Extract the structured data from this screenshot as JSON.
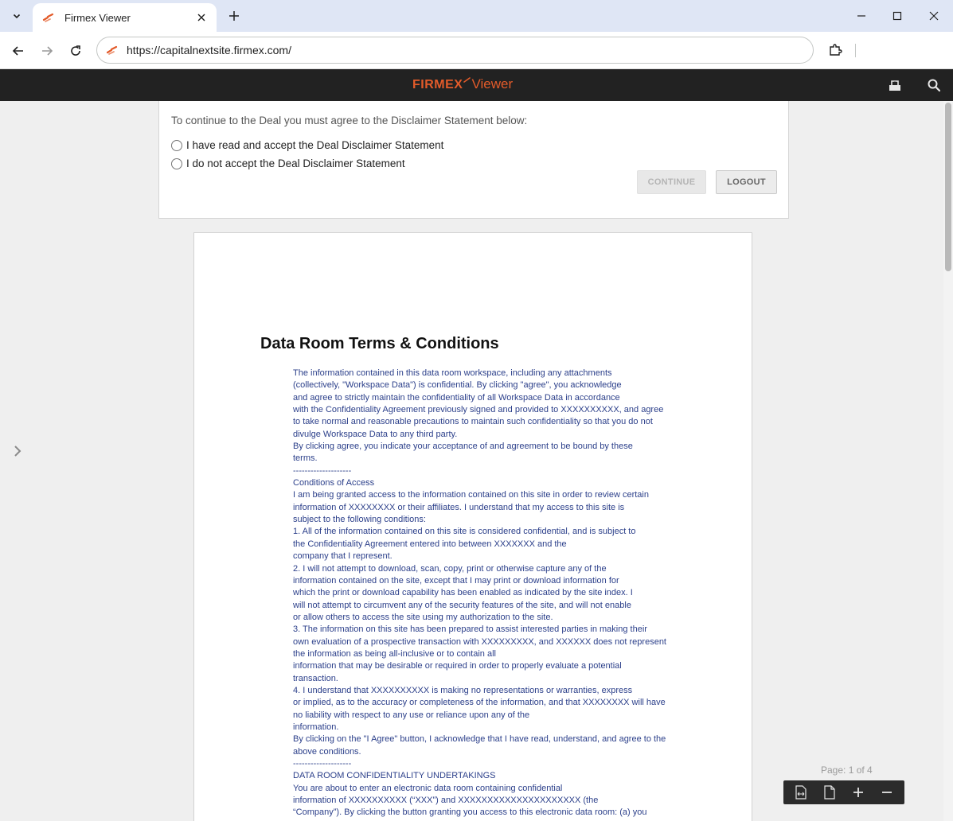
{
  "browser": {
    "tab": {
      "title": "Firmex Viewer"
    },
    "url": "https://capitalnextsite.firmex.com/"
  },
  "header": {
    "brand_firmex": "FIRMEX",
    "brand_viewer": "Viewer"
  },
  "disclaimer": {
    "prompt": "To continue to the Deal you must agree to the Disclaimer Statement below:",
    "accept_label": "I have read and accept the Deal Disclaimer Statement",
    "decline_label": "I do not accept the Deal Disclaimer Statement",
    "continue_label": "CONTINUE",
    "logout_label": "LOGOUT"
  },
  "document": {
    "title": "Data Room Terms & Conditions",
    "lines": [
      "The information contained in this data room workspace, including any attachments",
      "(collectively, \"Workspace Data\") is confidential. By clicking \"agree\", you acknowledge",
      "and agree to strictly maintain the confidentiality of all Workspace Data in accordance",
      "with the Confidentiality Agreement previously signed and provided to XXXXXXXXXX, and agree",
      "to take normal and reasonable precautions to maintain such confidentiality so that you do not",
      "divulge Workspace Data to any third party.",
      "By clicking agree, you indicate your acceptance of and agreement to be bound by these",
      "terms.",
      "--------------------",
      "Conditions of Access",
      "I am being granted access to the information contained on this site in order to review certain",
      "information of XXXXXXXX or their affiliates. I understand that my access to this site is",
      "subject to the following conditions:",
      "1. All of the information contained on this site is considered confidential, and is subject to",
      "the Confidentiality Agreement entered into between XXXXXXX and the",
      "company that I represent.",
      "2. I will not attempt to download, scan, copy, print or otherwise capture any of the",
      "information contained on the site, except that I may print or download information for",
      "which the print or download capability has been enabled as indicated by the site index. I",
      "will not attempt to circumvent any of the security features of the site, and will not enable",
      "or allow others to access the site using my authorization to the site.",
      "3. The information on this site has been prepared to assist interested parties in making their",
      "own evaluation of a prospective transaction with XXXXXXXXX, and XXXXXX does not represent",
      "the information as being all-inclusive or to contain all",
      "information that may be desirable or required in order to properly evaluate a potential",
      "transaction.",
      "4. I understand that XXXXXXXXXX is making no representations or warranties, express",
      "or implied, as to the accuracy or completeness of the information, and that XXXXXXXX will have",
      "no liability with respect to any use or reliance upon any of the",
      "information.",
      "By clicking on the \"I Agree\" button, I acknowledge that I have read, understand, and agree to the",
      "above conditions.",
      "--------------------",
      "DATA ROOM CONFIDENTIALITY UNDERTAKINGS",
      "You are about to enter an electronic data room containing confidential",
      "information of XXXXXXXXXX (“XXX”) and XXXXXXXXXXXXXXXXXXXXX (the",
      "“Company”). By clicking the button granting you access to this electronic data room: (a) you"
    ]
  },
  "pager": {
    "label": "Page: 1 of 4"
  },
  "colors": {
    "brand": "#e35b2a",
    "doc_text": "#2b3f8a",
    "header_bg": "#222222"
  }
}
